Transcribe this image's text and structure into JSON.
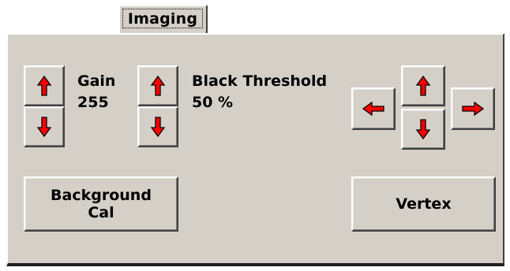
{
  "tab": {
    "label": "Imaging"
  },
  "gain": {
    "label": "Gain",
    "value": "255"
  },
  "black_threshold": {
    "label": "Black Threshold",
    "value": "50 %"
  },
  "buttons": {
    "background_cal_line1": "Background",
    "background_cal_line2": "Cal",
    "vertex": "Vertex"
  },
  "icons": {
    "up": "up-arrow-icon",
    "down": "down-arrow-icon",
    "left": "left-arrow-icon",
    "right": "right-arrow-icon"
  },
  "colors": {
    "arrow": "#ff0000",
    "face": "#d4d0c8"
  }
}
